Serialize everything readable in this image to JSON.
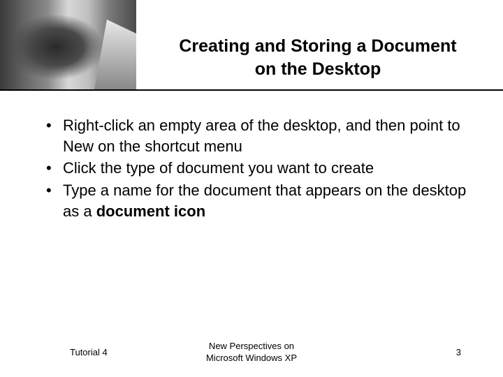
{
  "header": {
    "title_line1": "Creating and Storing a Document",
    "title_line2": "on the Desktop"
  },
  "bullets": [
    {
      "text": "Right-click an empty area of the desktop, and then point to New on the shortcut menu",
      "bold_fragment": null
    },
    {
      "text": "Click the type of document you want to create",
      "bold_fragment": null
    },
    {
      "text": "Type a name for the document that appears on the desktop as a ",
      "bold_fragment": "document icon"
    }
  ],
  "footer": {
    "left": "Tutorial 4",
    "center_line1": "New Perspectives on",
    "center_line2": "Microsoft Windows XP",
    "right": "3"
  }
}
